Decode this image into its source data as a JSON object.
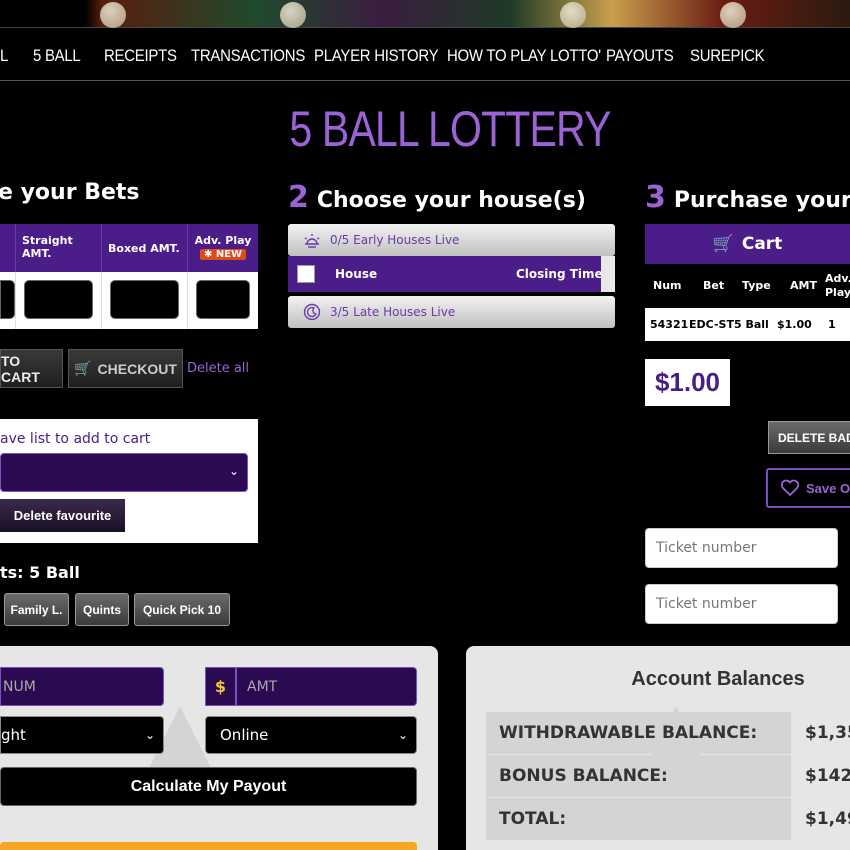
{
  "nav": {
    "items": [
      "L",
      "5 BALL",
      "RECEIPTS",
      "TRANSACTIONS",
      "PLAYER HISTORY",
      "HOW TO PLAY LOTTO'",
      "PAYOUTS",
      "SUREPICK"
    ]
  },
  "page_title": "5 BALL LOTTERY",
  "step1": {
    "title": "e your Bets"
  },
  "bets_table": {
    "headers": [
      "Straight AMT.",
      "Boxed AMT.",
      "Adv. Play"
    ],
    "badge": "NEW"
  },
  "buttons": {
    "add_to_cart": "TO CART",
    "checkout": "CHECKOUT",
    "delete_all": "Delete all",
    "delete_favourite": "Delete favourite",
    "calculate": "Calculate My Payout",
    "delete_bad": "DELETE BAD I",
    "save": "Save Or"
  },
  "favourites": {
    "label": "ave list to add to cart"
  },
  "bets_subtitle": "ts: 5 Ball",
  "quick_picks": [
    "Family L.",
    "Quints",
    "Quick Pick 10"
  ],
  "step2": {
    "number": "2",
    "title": "Choose your house(s)",
    "early": "0/5 Early Houses Live",
    "late": "3/5 Late Houses Live",
    "col_house": "House",
    "col_closing": "Closing Time"
  },
  "step3": {
    "number": "3",
    "title": "Purchase your be",
    "cart_label": "Cart",
    "columns": [
      "Num",
      "Bet",
      "Type",
      "AMT",
      "Adv. Play"
    ],
    "row": [
      "54321",
      "EDC-ST",
      "5 Ball",
      "$1.00",
      "1"
    ],
    "total": "$1.00"
  },
  "tickets": {
    "placeholder": "Ticket number"
  },
  "calculator": {
    "num_placeholder": "NUM",
    "currency": "$",
    "amt_placeholder": "AMT",
    "bet_type": "ght",
    "channel": "Online"
  },
  "balances": {
    "title": "Account Balances",
    "rows": [
      {
        "label": "WITHDRAWABLE BALANCE:",
        "value": "$1,35"
      },
      {
        "label": "BONUS BALANCE:",
        "value": "$142."
      },
      {
        "label": "TOTAL:",
        "value": "$1,49"
      }
    ]
  },
  "colors": {
    "accent_purple": "#9b63d6",
    "header_purple": "#4a1d88",
    "gold": "#f4c531",
    "orange": "#f6a623"
  },
  "icons": [
    "cart-icon",
    "sunrise-icon",
    "moon-icon",
    "heart-icon",
    "chevron-down-icon"
  ]
}
